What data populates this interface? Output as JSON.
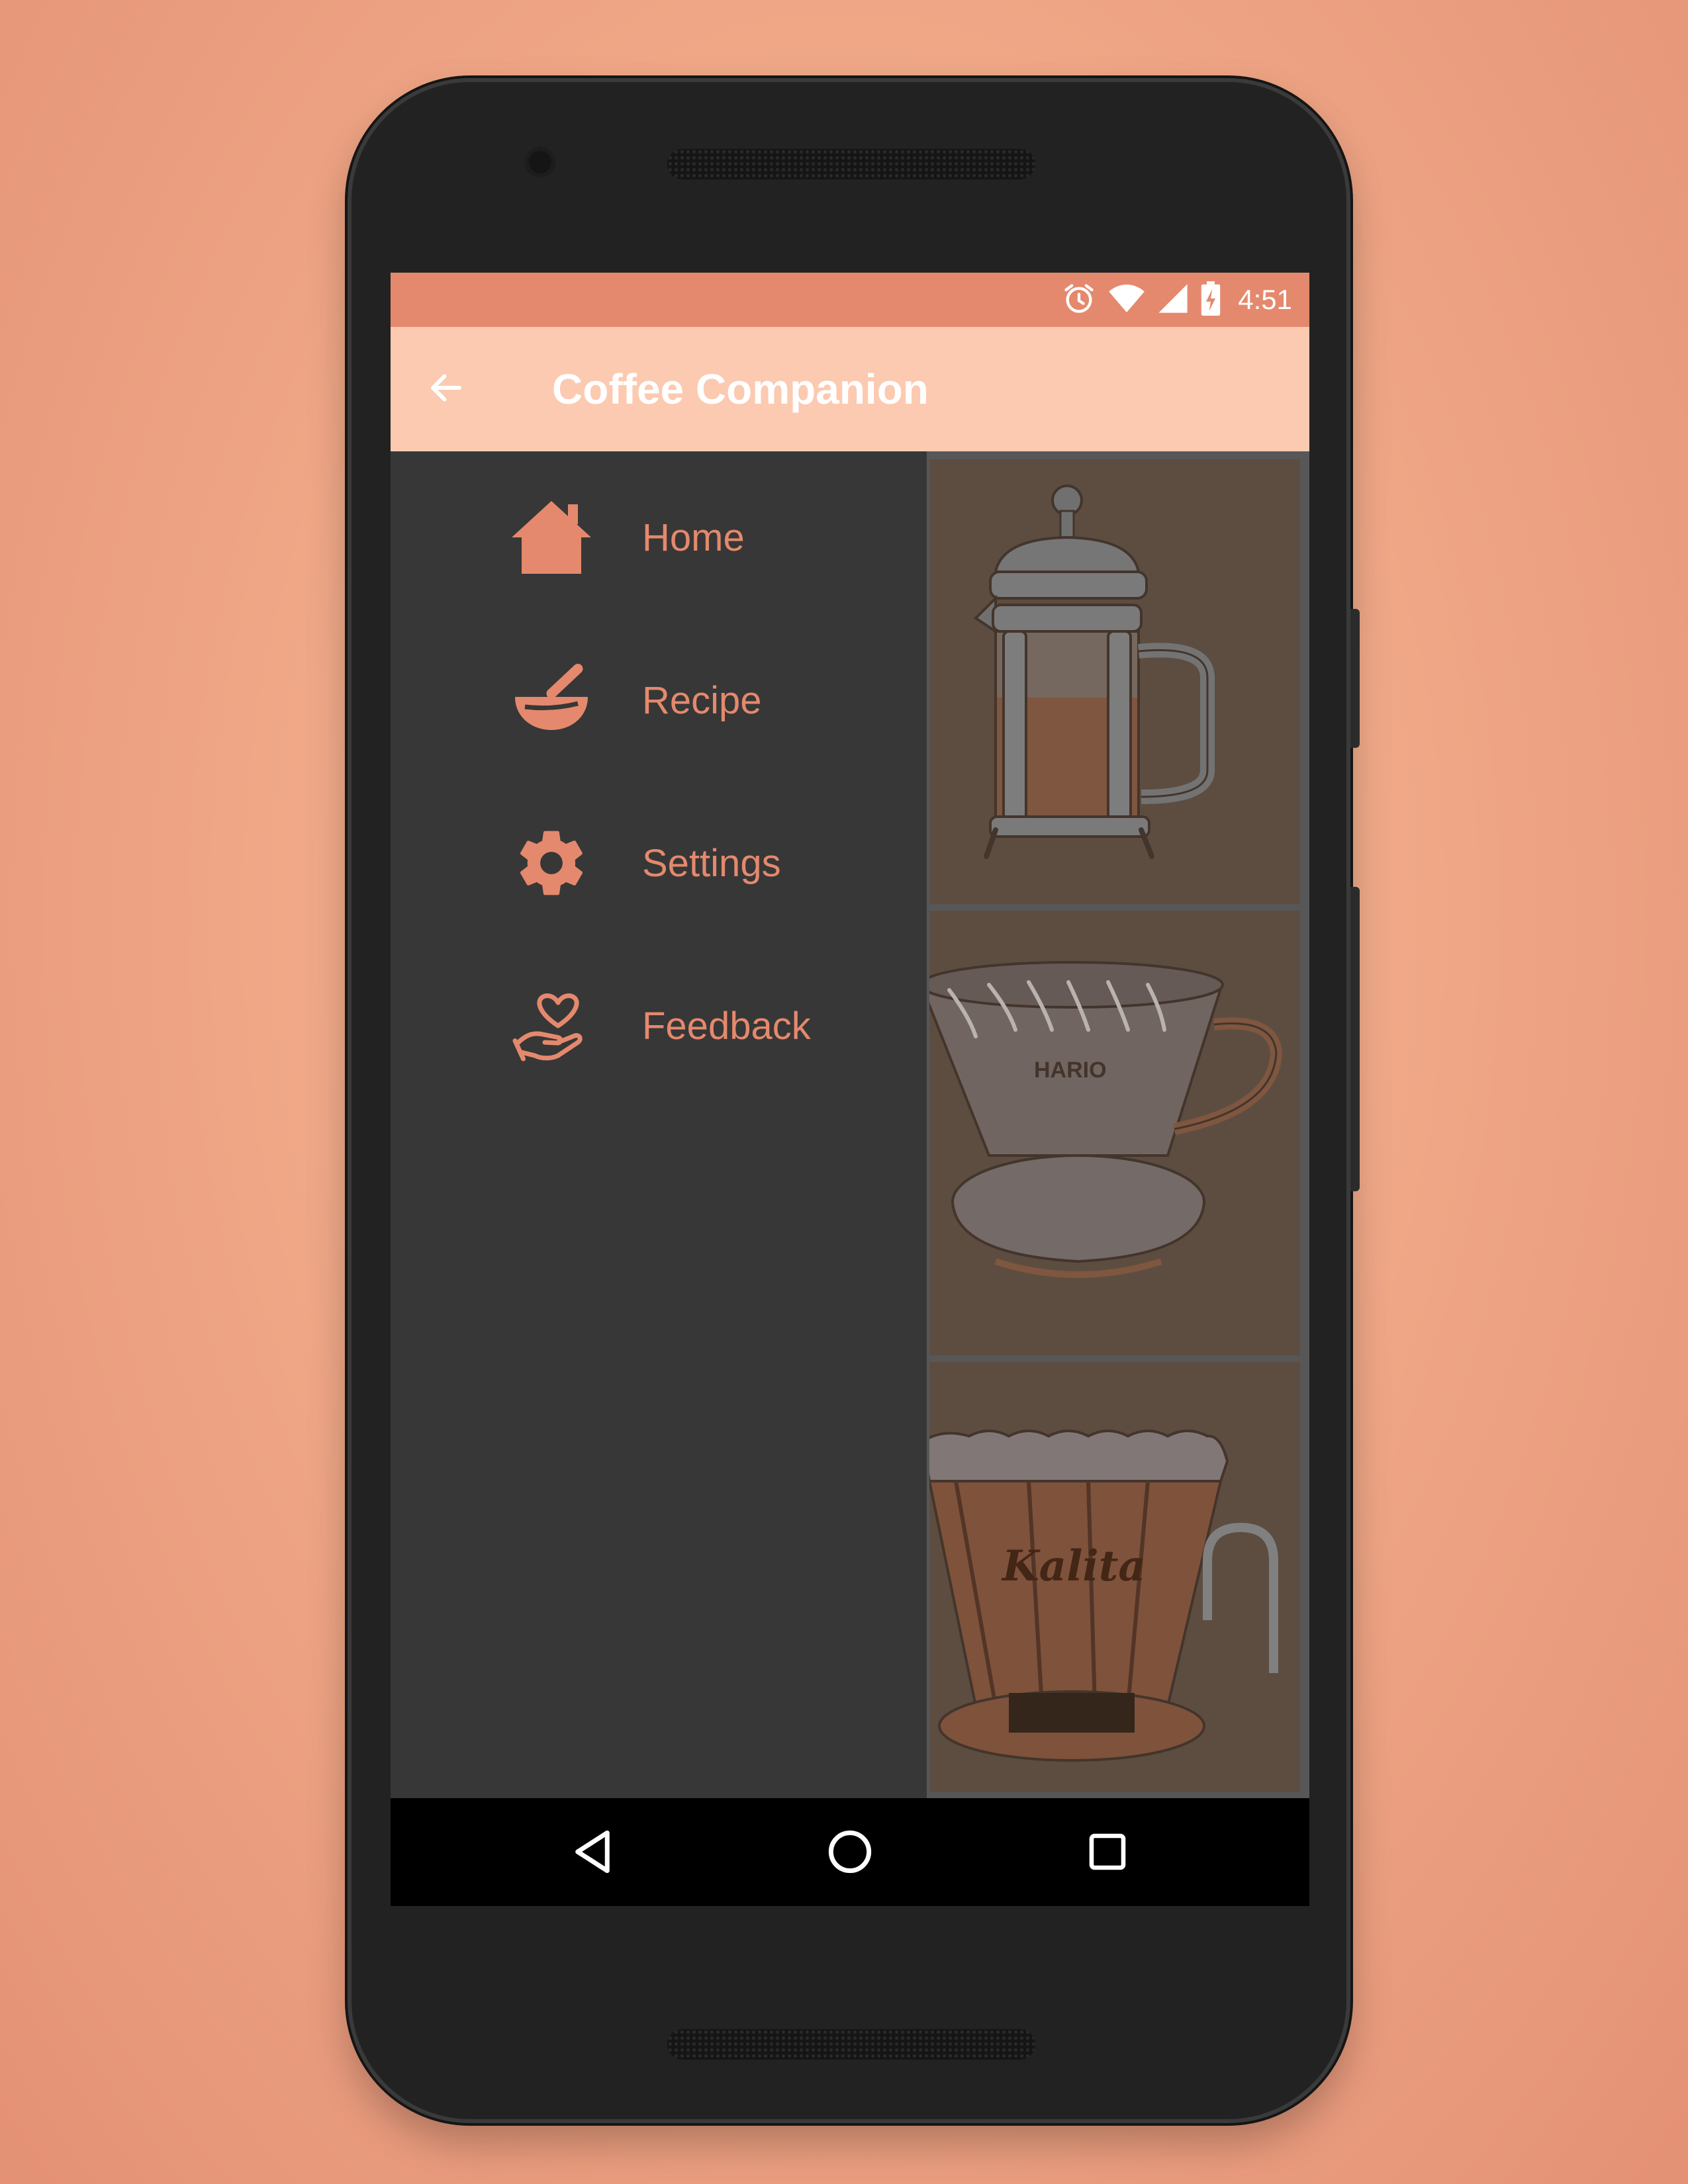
{
  "status_bar": {
    "time": "4:51",
    "icons": [
      "alarm-icon",
      "wifi-icon",
      "cell-signal-icon",
      "battery-charging-icon"
    ]
  },
  "app_bar": {
    "title": "Coffee Companion",
    "nav_icon": "arrow-back-icon"
  },
  "drawer": {
    "items": [
      {
        "label": "Home",
        "icon": "home-icon"
      },
      {
        "label": "Recipe",
        "icon": "mortar-pestle-icon"
      },
      {
        "label": "Settings",
        "icon": "gear-icon"
      },
      {
        "label": "Feedback",
        "icon": "heart-hand-icon"
      }
    ]
  },
  "content": {
    "cards": [
      {
        "illustration": "french-press"
      },
      {
        "illustration": "hario-dripper",
        "printed_text": "HARIO"
      },
      {
        "illustration": "kalita-dripper",
        "printed_text": "Kalita"
      }
    ]
  },
  "nav_bar": {
    "buttons": [
      "back-triangle-icon",
      "home-circle-icon",
      "recents-square-icon"
    ]
  },
  "colors": {
    "accent": "#e4896d",
    "app_bar": "#fbcab1",
    "drawer": "#373737",
    "background": "#f2ad8d"
  }
}
